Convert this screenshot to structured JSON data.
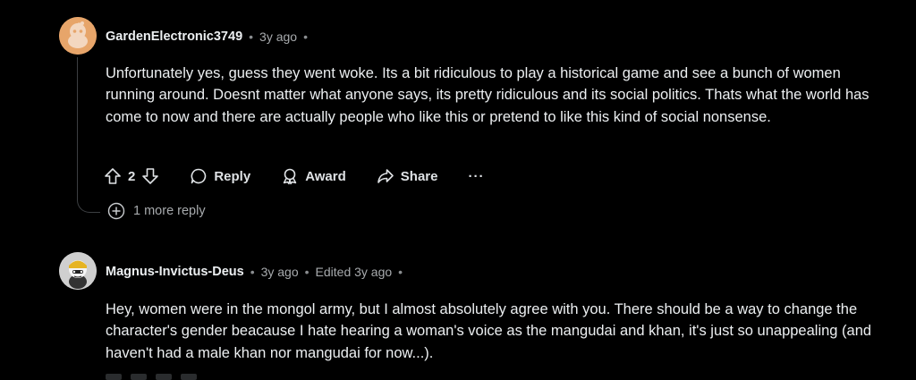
{
  "comment1": {
    "username": "GardenElectronic3749",
    "time": "3y ago",
    "body": "Unfortunately yes, guess they went woke. Its a bit ridiculous to play a historical game and see a bunch of women running around. Doesnt matter what anyone says, its pretty ridiculous and its social politics. Thats what the world has come to now and there are actually people who like this or pretend to like this kind of social nonsense.",
    "vote_count": "2",
    "actions": {
      "reply": "Reply",
      "award": "Award",
      "share": "Share",
      "more": "···"
    },
    "more_replies": "1 more reply"
  },
  "comment2": {
    "username": "Magnus-Invictus-Deus",
    "time": "3y ago",
    "edited": "Edited 3y ago",
    "body": "Hey, women were in the mongol army, but I almost absolutely agree with you. There should be a way to change the character's gender beacause I hate hearing a woman's voice as the mangudai and khan, it's just so unappealing (and haven't had a male khan nor mangudai for now...)."
  },
  "colors": {
    "background": "#000000",
    "text": "#eceff1",
    "muted": "#a7aaad",
    "avatar1": "#e7a56a"
  }
}
